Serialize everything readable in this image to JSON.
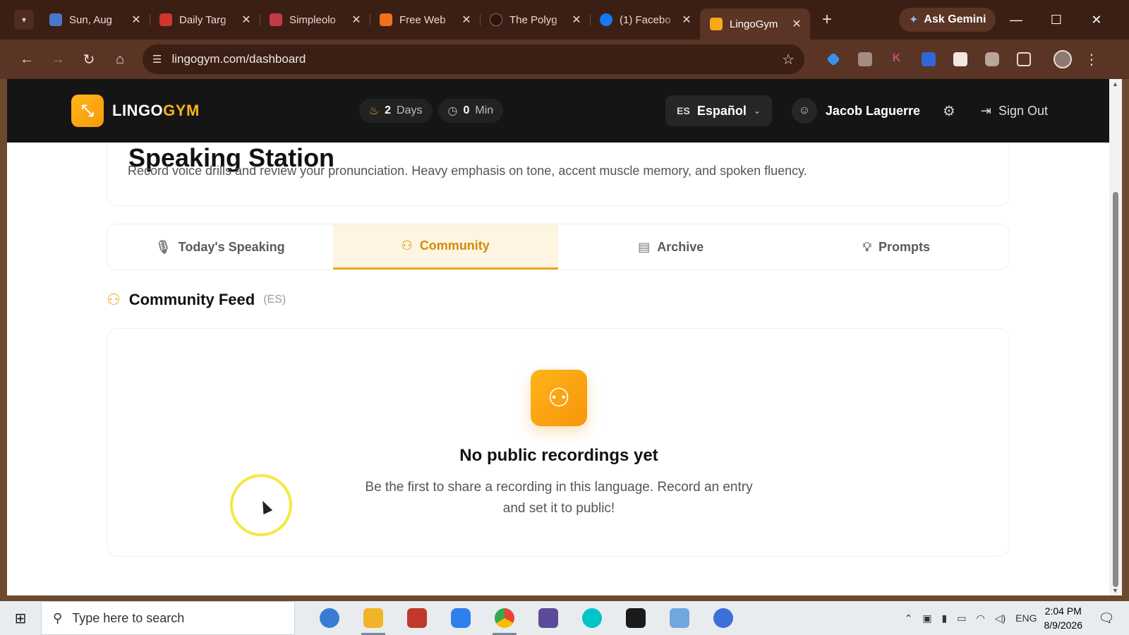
{
  "browser": {
    "tabs": [
      {
        "title": "Sun, Aug",
        "favicon_color": "#4a78c8"
      },
      {
        "title": "Daily Targ",
        "favicon_color": "#d0352b"
      },
      {
        "title": "Simpleolo",
        "favicon_color": "#c23b4a"
      },
      {
        "title": "Free Web",
        "favicon_color": "#f07020"
      },
      {
        "title": "The Polyg",
        "favicon_color": "#3b1f14"
      },
      {
        "title": "(1) Facebo",
        "favicon_color": "#1877f2"
      },
      {
        "title": "LingoGym",
        "favicon_color": "#f7a916",
        "active": true
      }
    ],
    "new_tab_icon": "+",
    "gemini_label": "Ask Gemini",
    "url": "lingogym.com/dashboard"
  },
  "app": {
    "logo_prefix": "LINGO",
    "logo_suffix": "GYM",
    "streak_value": "2",
    "streak_unit": "Days",
    "minutes_value": "0",
    "minutes_unit": "Min",
    "language_code": "ES",
    "language_name": "Español",
    "user_name": "Jacob Laguerre",
    "sign_out": "Sign Out"
  },
  "page": {
    "title": "Speaking Station",
    "description": "Record voice drills and review your pronunciation. Heavy emphasis on tone, accent muscle memory, and spoken fluency.",
    "tabs": [
      {
        "label": "Today's Speaking",
        "icon": "mic-icon"
      },
      {
        "label": "Community",
        "icon": "users-icon",
        "active": true
      },
      {
        "label": "Archive",
        "icon": "archive-icon"
      },
      {
        "label": "Prompts",
        "icon": "lightbulb-icon"
      }
    ],
    "feed_title": "Community Feed",
    "feed_code": "(ES)",
    "empty_title": "No public recordings yet",
    "empty_desc": "Be the first to share a recording in this language. Record an entry and set it to public!"
  },
  "taskbar": {
    "search_placeholder": "Type here to search",
    "language": "ENG",
    "time": "2:04 PM",
    "date": "8/9/2026",
    "apps": [
      "#3a7bd5",
      "#f0b429",
      "#c0392b",
      "#2f80ed",
      "#34a853",
      "#5b4b9a",
      "#00c4cc",
      "#1a1a1a",
      "#6fa8dc",
      "#3d6fd9"
    ]
  },
  "colors": {
    "accent": "#f0a616",
    "header_bg": "#151515",
    "chrome_bg": "#3b1f14"
  }
}
